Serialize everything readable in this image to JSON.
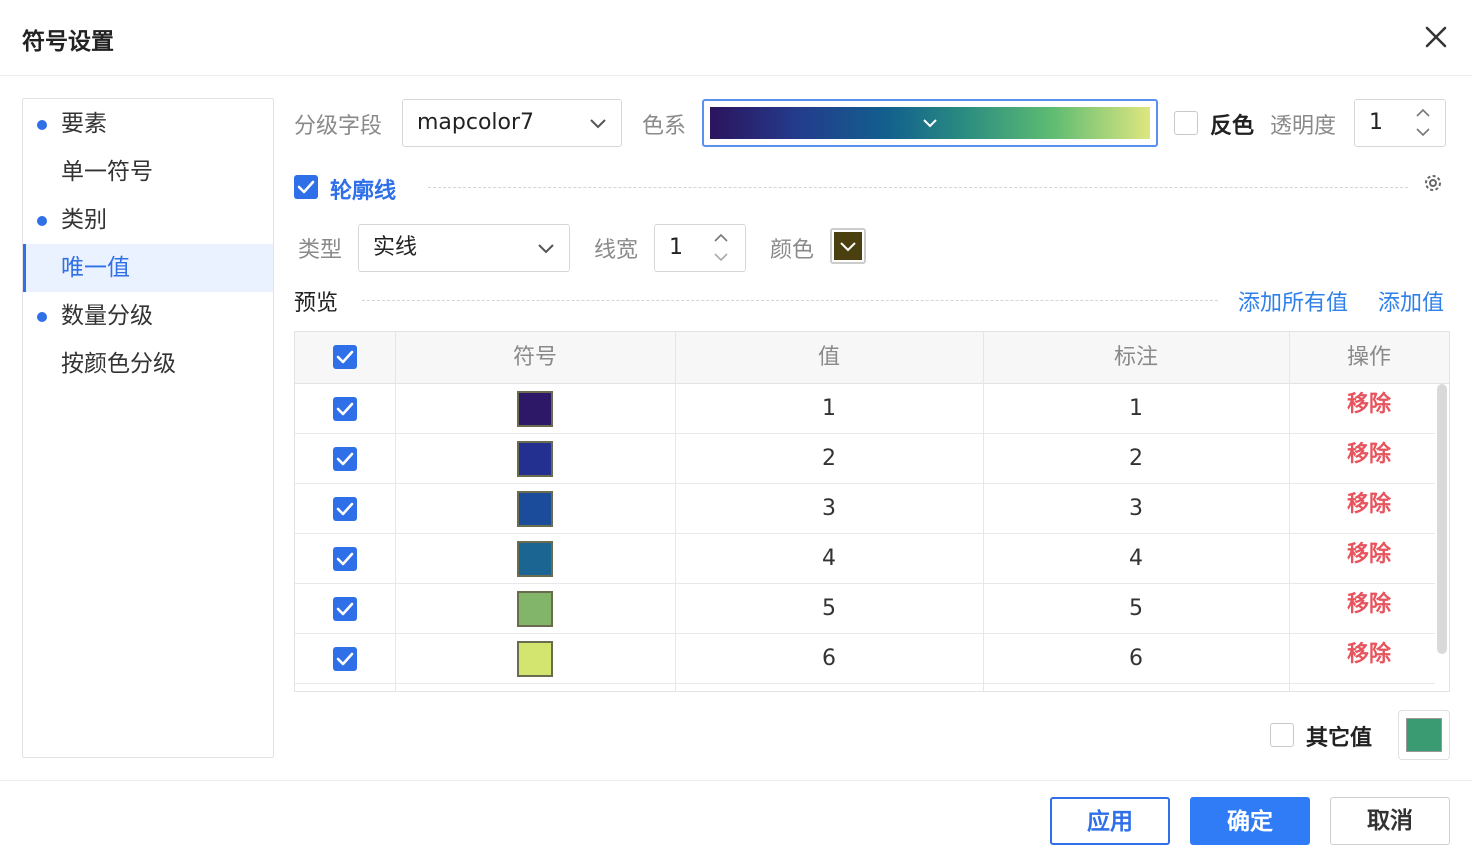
{
  "dialog": {
    "title": "符号设置"
  },
  "sidebar": {
    "items": [
      {
        "label": "要素",
        "dot": true,
        "active": false
      },
      {
        "label": "单一符号",
        "dot": false,
        "active": false
      },
      {
        "label": "类别",
        "dot": true,
        "active": false
      },
      {
        "label": "唯一值",
        "dot": false,
        "active": true
      },
      {
        "label": "数量分级",
        "dot": true,
        "active": false
      },
      {
        "label": "按颜色分级",
        "dot": false,
        "active": false
      }
    ]
  },
  "form": {
    "field_label": "分级字段",
    "field_value": "mapcolor7",
    "ramp_label": "色系",
    "ramp_colors": [
      "#2c145e",
      "#233c8c",
      "#125f8d",
      "#2a8d80",
      "#5fbc72",
      "#dfe680"
    ],
    "reverse_label": "反色",
    "reverse_checked": false,
    "opacity_label": "透明度",
    "opacity_value": "1",
    "outline_label": "轮廓线",
    "outline_checked": true,
    "type_label": "类型",
    "type_value": "实线",
    "width_label": "线宽",
    "width_value": "1",
    "color_label": "颜色",
    "outline_color": "#4a3f0f"
  },
  "preview": {
    "label": "预览",
    "add_all_label": "添加所有值",
    "add_label": "添加值"
  },
  "table": {
    "headers": {
      "symbol": "符号",
      "value": "值",
      "note": "标注",
      "action": "操作"
    },
    "header_checked": true,
    "rows": [
      {
        "checked": true,
        "color": "#2d1767",
        "value": "1",
        "note": "1",
        "action": "移除"
      },
      {
        "checked": true,
        "color": "#23308f",
        "value": "2",
        "note": "2",
        "action": "移除"
      },
      {
        "checked": true,
        "color": "#1b4c9c",
        "value": "3",
        "note": "3",
        "action": "移除"
      },
      {
        "checked": true,
        "color": "#1a6592",
        "value": "4",
        "note": "4",
        "action": "移除"
      },
      {
        "checked": true,
        "color": "#82b46a",
        "value": "5",
        "note": "5",
        "action": "移除"
      },
      {
        "checked": true,
        "color": "#d3e56f",
        "value": "6",
        "note": "6",
        "action": "移除"
      }
    ]
  },
  "other": {
    "label": "其它值",
    "checked": false,
    "color": "#3a9a72"
  },
  "footer": {
    "apply_label": "应用",
    "ok_label": "确定",
    "cancel_label": "取消"
  },
  "colors": {
    "accent": "#2f6fe8",
    "danger": "#e8545e"
  }
}
